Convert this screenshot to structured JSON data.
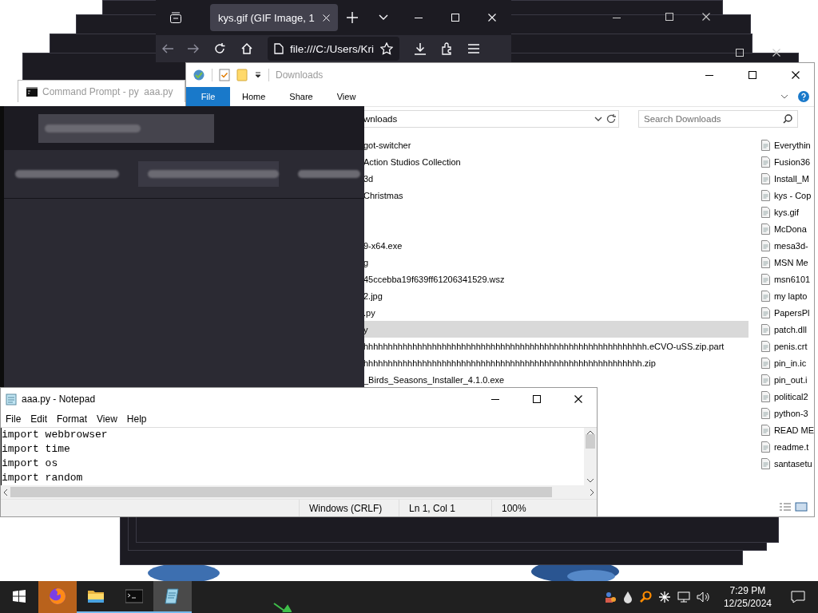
{
  "browser": {
    "tab": {
      "title": "kys.gif (GIF Image, 1",
      "selected": true
    },
    "address": "file:///C:/Users/Kri"
  },
  "command_prompt": {
    "title": "Command Prompt - py  aaa.py"
  },
  "explorer": {
    "title": "Downloads",
    "ribbon_tabs": [
      {
        "label": "File",
        "selected": true
      },
      {
        "label": "Home",
        "selected": false
      },
      {
        "label": "Share",
        "selected": false
      },
      {
        "label": "View",
        "selected": false
      }
    ],
    "address": "wnloads",
    "search": {
      "placeholder": "Search Downloads"
    },
    "files": [
      {
        "name": "got-switcher",
        "selected": false
      },
      {
        "name": "Action Studios Collection",
        "selected": false
      },
      {
        "name": "3d",
        "selected": false
      },
      {
        "name": "Christmas",
        "selected": false
      },
      {
        "selected": false
      },
      {
        "selected": false
      },
      {
        "name": "9-x64.exe",
        "selected": false
      },
      {
        "name": "g",
        "selected": false
      },
      {
        "name": "45ccebba19f639ff61206341529.wsz",
        "selected": false
      },
      {
        "name": "2.jpg",
        "selected": false
      },
      {
        "name": ".py",
        "selected": false
      },
      {
        "name": "y",
        "selected": true
      },
      {
        "name": "hhhhhhhhhhhhhhhhhhhhhhhhhhhhhhhhhhhhhhhhhhhhhhhhhhhhhhhhhh.eCVO-uSS.zip.part",
        "selected": false
      },
      {
        "name": "hhhhhhhhhhhhhhhhhhhhhhhhhhhhhhhhhhhhhhhhhhhhhhhhhhhhhhhhh.zip",
        "selected": false
      },
      {
        "name": "_Birds_Seasons_Installer_4.1.0.exe",
        "selected": false
      }
    ],
    "files_column_2": [
      {
        "name": "Everythin",
        "selected": false
      },
      {
        "name": "Fusion36",
        "selected": false
      },
      {
        "name": "Install_M",
        "selected": false
      },
      {
        "name": "kys - Cop",
        "selected": false
      },
      {
        "name": "kys.gif",
        "selected": false
      },
      {
        "name": "McDona",
        "selected": false
      },
      {
        "name": "mesa3d-",
        "selected": false
      },
      {
        "name": "MSN Me",
        "selected": false
      },
      {
        "name": "msn6101",
        "selected": false
      },
      {
        "name": "my lapto",
        "selected": false
      },
      {
        "name": "PapersPl",
        "selected": false
      },
      {
        "name": "patch.dll",
        "selected": false
      },
      {
        "name": "penis.crt",
        "selected": false
      },
      {
        "name": "pin_in.ic",
        "selected": false
      },
      {
        "name": "pin_out.i",
        "selected": false
      },
      {
        "name": "political2",
        "selected": false
      },
      {
        "name": "python-3",
        "selected": false
      },
      {
        "name": "READ ME",
        "selected": false
      },
      {
        "name": "readme.t",
        "selected": false
      },
      {
        "name": "santasetu",
        "selected": false
      }
    ]
  },
  "notepad": {
    "title": "aaa.py - Notepad",
    "menu": [
      "File",
      "Edit",
      "Format",
      "View",
      "Help"
    ],
    "lines": [
      "import webbrowser",
      "import time",
      "import os",
      "import random"
    ],
    "status": [
      "Windows (CRLF)",
      "Ln 1, Col 1",
      "100%"
    ]
  },
  "taskbar": {
    "apps": [
      {
        "kind": "firefox",
        "flashing": true,
        "active": false,
        "running": false
      },
      {
        "kind": "folder",
        "flashing": false,
        "active": false,
        "running": true
      },
      {
        "kind": "console",
        "flashing": false,
        "active": false,
        "running": true
      },
      {
        "kind": "notepad",
        "flashing": false,
        "active": true,
        "running": true
      }
    ],
    "clock": {
      "time": "7:29 PM",
      "date": "12/25/2024"
    }
  }
}
